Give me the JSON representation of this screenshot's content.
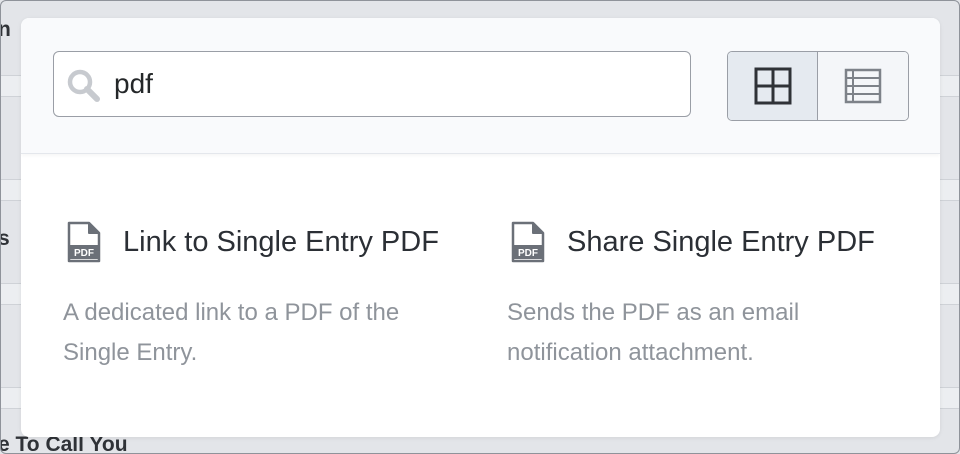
{
  "background": {
    "fragments": [
      "n",
      "s",
      "e To Call You"
    ]
  },
  "search": {
    "value": "pdf",
    "icon": "search-icon"
  },
  "view_toggle": {
    "grid_icon": "grid-view-icon",
    "list_icon": "list-view-icon",
    "active": "grid"
  },
  "results": [
    {
      "icon": "pdf-file-icon",
      "icon_text": "PDF",
      "title": "Link to Single Entry PDF",
      "description_line1": "A dedicated link to a PDF of the",
      "description_line2": "Single Entry."
    },
    {
      "icon": "pdf-file-icon",
      "icon_text": "PDF",
      "title": "Share Single Entry PDF",
      "description_line1": "Sends the PDF as an email",
      "description_line2": "notification attachment."
    }
  ],
  "colors": {
    "overlay": "#e3e5e9",
    "modal_bg": "#ffffff",
    "header_bg": "#f9fafc",
    "title_text": "#2b2f35",
    "desc_text": "#8f949b",
    "icon_gray": "#6b7078",
    "toggle_active_bg": "#e5eaf0"
  }
}
